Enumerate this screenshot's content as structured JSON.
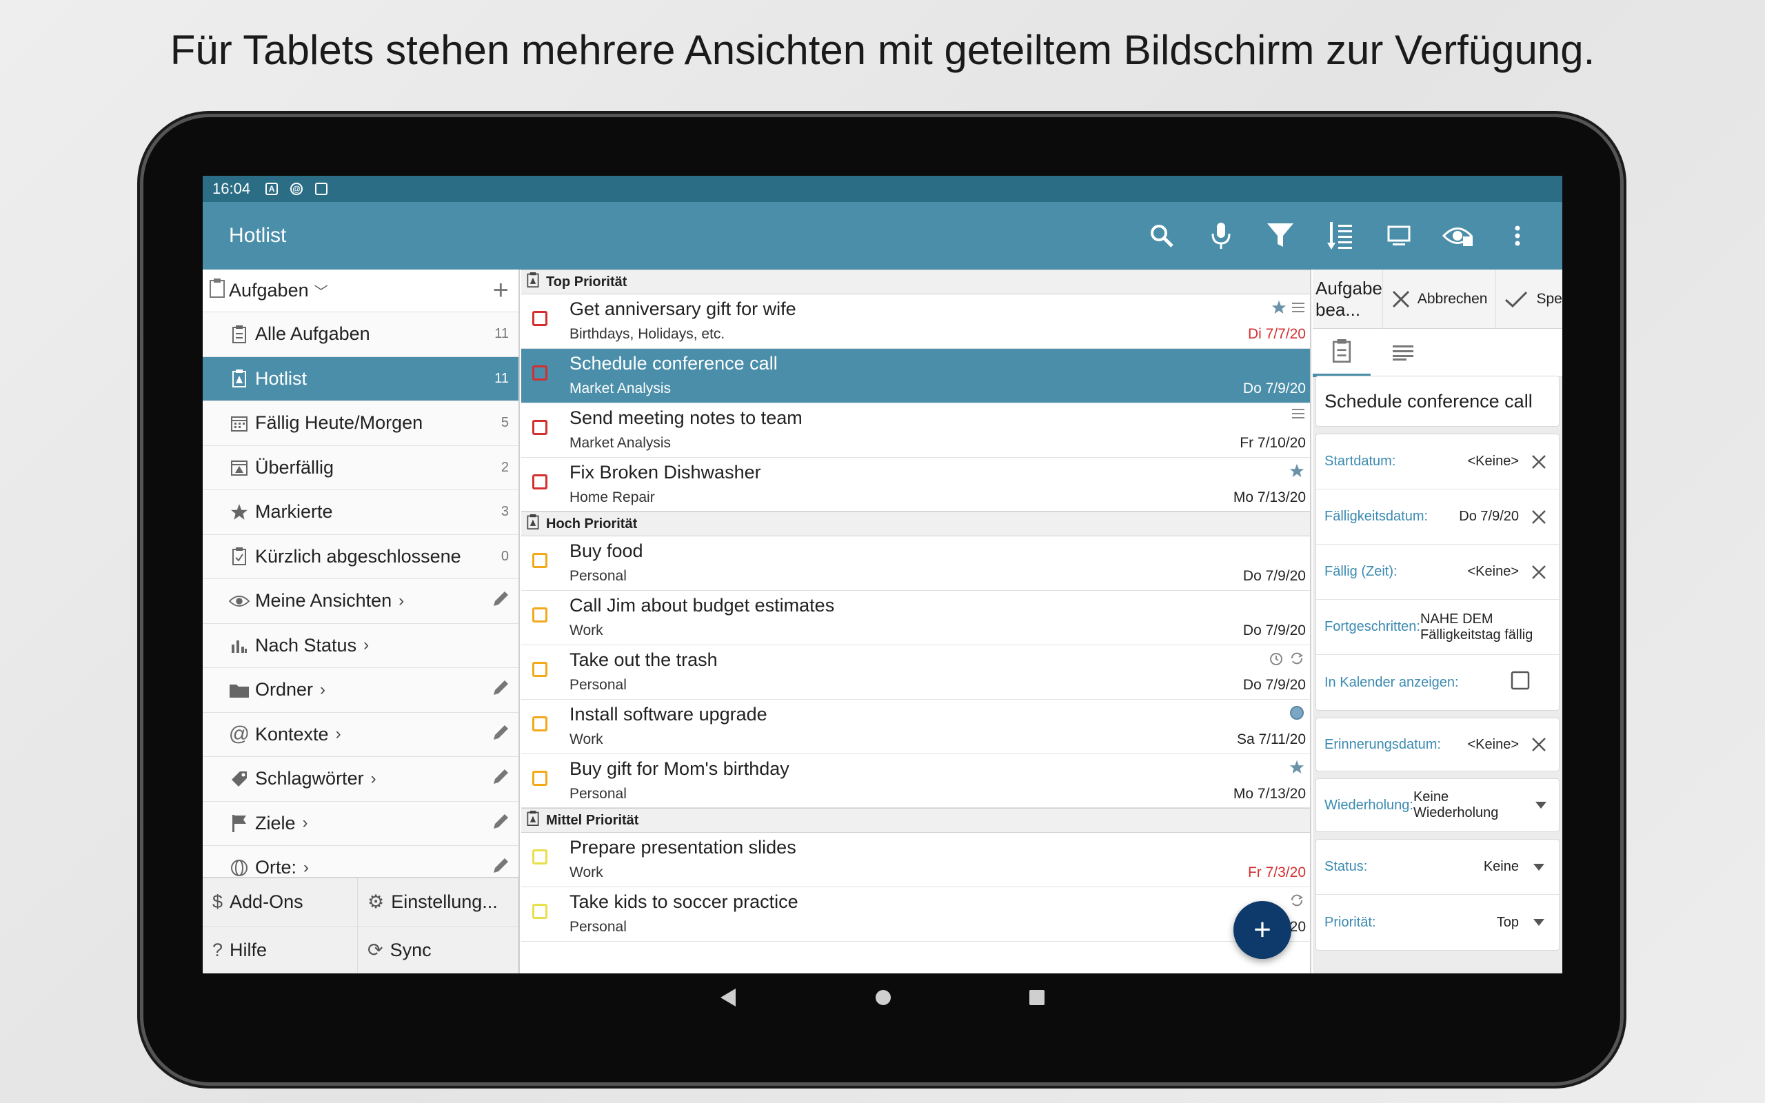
{
  "caption": "Für Tablets stehen mehrere Ansichten mit geteiltem Bildschirm zur Verfügung.",
  "statusbar": {
    "time": "16:04"
  },
  "appbar": {
    "title": "Hotlist",
    "actions": [
      "search-icon",
      "mic-icon",
      "filter-icon",
      "sort-icon",
      "monitor-icon",
      "view-icon",
      "more-icon"
    ]
  },
  "left": {
    "header": "Aufgaben",
    "items": [
      {
        "label": "Alle Aufgaben",
        "count": "11",
        "icon": "clipboard-icon"
      },
      {
        "label": "Hotlist",
        "count": "11",
        "icon": "hotlist-icon"
      },
      {
        "label": "Fällig Heute/Morgen",
        "count": "5",
        "icon": "calendar-icon"
      },
      {
        "label": "Überfällig",
        "count": "2",
        "icon": "calendar-overdue-icon"
      },
      {
        "label": "Markierte",
        "count": "3",
        "icon": "star-icon"
      },
      {
        "label": "Kürzlich abgeschlossene",
        "count": "0",
        "icon": "check-clipboard-icon"
      },
      {
        "label": "Meine Ansichten",
        "icon": "eye-icon"
      },
      {
        "label": "Nach Status",
        "icon": "bar-chart-icon"
      },
      {
        "label": "Ordner",
        "icon": "folder-icon"
      },
      {
        "label": "Kontexte",
        "icon": "at-icon"
      },
      {
        "label": "Schlagwörter",
        "icon": "tag-icon"
      },
      {
        "label": "Ziele",
        "icon": "flag-icon"
      },
      {
        "label": "Orte:",
        "icon": "globe-icon"
      }
    ],
    "bottom": {
      "addons": "Add-Ons",
      "settings": "Einstellung...",
      "help": "Hilfe",
      "sync": "Sync"
    }
  },
  "groups": {
    "top": "Top Priorität",
    "high": "Hoch Priorität",
    "mid": "Mittel Priorität"
  },
  "tasks": [
    {
      "title": "Get anniversary gift for wife",
      "sub": "Birthdays, Holidays, etc.",
      "date": "Di 7/7/20"
    },
    {
      "title": "Schedule conference call",
      "sub": "Market Analysis",
      "date": "Do 7/9/20"
    },
    {
      "title": "Send meeting notes to team",
      "sub": "Market Analysis",
      "date": "Fr 7/10/20"
    },
    {
      "title": "Fix Broken Dishwasher",
      "sub": "Home Repair",
      "date": "Mo 7/13/20"
    },
    {
      "title": "Buy food",
      "sub": "Personal",
      "date": "Do 7/9/20"
    },
    {
      "title": "Call Jim about budget estimates",
      "sub": "Work",
      "date": "Do 7/9/20"
    },
    {
      "title": "Take out the trash",
      "sub": "Personal",
      "date": "Do 7/9/20"
    },
    {
      "title": "Install software upgrade",
      "sub": "Work",
      "date": "Sa 7/11/20"
    },
    {
      "title": "Buy gift for Mom's birthday",
      "sub": "Personal",
      "date": "Mo 7/13/20"
    },
    {
      "title": "Prepare presentation slides",
      "sub": "Work",
      "date": "Fr 7/3/20"
    },
    {
      "title": "Take kids to soccer practice",
      "sub": "Personal",
      "date": "M…20"
    }
  ],
  "detail": {
    "toolbar_title": "Aufgabe bea...",
    "cancel": "Abbrechen",
    "save": "Speichern",
    "task_title": "Schedule conference call",
    "start_label": "Startdatum:",
    "start_value": "<Keine>",
    "due_label": "Fälligkeitsdatum:",
    "due_value": "Do 7/9/20",
    "duetime_label": "Fällig (Zeit):",
    "duetime_value": "<Keine>",
    "advanced_label": "Fortgeschritten:",
    "advanced_value": "NAHE DEM Fälligkeitstag fällig",
    "calendar_label": "In Kalender anzeigen:",
    "reminder_label": "Erinnerungsdatum:",
    "reminder_value": "<Keine>",
    "repeat_label": "Wiederholung:",
    "repeat_value": "Keine Wiederholung",
    "status_label": "Status:",
    "status_value": "Keine",
    "priority_label": "Priorität:",
    "priority_value": "Top"
  },
  "colors": {
    "accent": "#4a8ea9",
    "statusbar": "#2b6d84",
    "top": "#d32f2f",
    "high": "#f3a81a",
    "mid": "#e8e04a",
    "fab": "#0d3a6b"
  }
}
